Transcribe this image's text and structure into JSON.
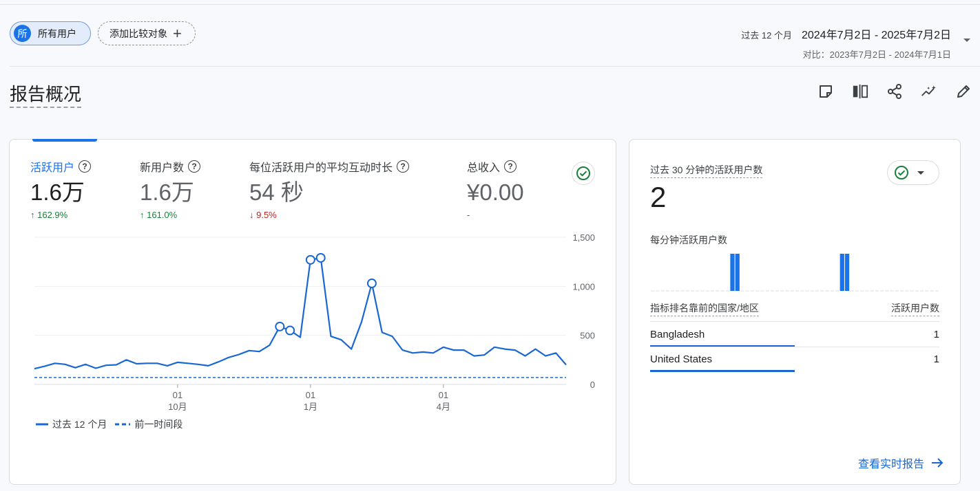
{
  "filters": {
    "all_users_avatar": "所",
    "all_users_label": "所有用户",
    "add_comparison_label": "添加比较对象",
    "add_icon": "plus-icon"
  },
  "date_range": {
    "preset": "过去 12 个月",
    "range": "2024年7月2日 - 2025年7月2日",
    "compare": "对比：2023年7月2日 - 2024年7月1日"
  },
  "page_title": "报告概况",
  "toolbar": {
    "icons": [
      "note-icon",
      "compare-columns-icon",
      "share-icon",
      "insights-icon",
      "edit-icon"
    ]
  },
  "metrics": [
    {
      "label": "活跃用户",
      "value": "1.6万",
      "change": "↑ 162.9%",
      "direction": "up"
    },
    {
      "label": "新用户数",
      "value": "1.6万",
      "change": "↑ 161.0%",
      "direction": "up"
    },
    {
      "label": "每位活跃用户的平均互动时长",
      "value": "54 秒",
      "change": "↓ 9.5%",
      "direction": "down"
    },
    {
      "label": "总收入",
      "value": "¥0.00",
      "change": "-",
      "direction": "none"
    }
  ],
  "chart_data": {
    "type": "line",
    "y_ticks": [
      "1,500",
      "1,000",
      "500",
      "0"
    ],
    "ylim": [
      0,
      1500
    ],
    "x_ticks": [
      {
        "day": "01",
        "month": "10月",
        "index": 14
      },
      {
        "day": "01",
        "month": "1月",
        "index": 27
      },
      {
        "day": "01",
        "month": "4月",
        "index": 40
      }
    ],
    "series": [
      {
        "name": "过去 12 个月",
        "style": "solid",
        "color": "#1967d2",
        "values": [
          160,
          185,
          215,
          205,
          170,
          205,
          165,
          195,
          200,
          250,
          210,
          215,
          215,
          190,
          225,
          215,
          205,
          190,
          230,
          275,
          305,
          345,
          335,
          400,
          590,
          550,
          480,
          1270,
          1290,
          490,
          455,
          360,
          640,
          1030,
          530,
          490,
          350,
          320,
          330,
          320,
          380,
          350,
          350,
          290,
          300,
          380,
          360,
          350,
          290,
          360,
          290,
          320,
          200
        ],
        "markers": [
          24,
          25,
          27,
          28,
          33
        ]
      },
      {
        "name": "前一时间段",
        "style": "dashed",
        "color": "#1967d2",
        "values": [
          70,
          70,
          70,
          70,
          70,
          70,
          70,
          70,
          70,
          70,
          70,
          70,
          70,
          70,
          70,
          70,
          70,
          70,
          70,
          70,
          70,
          70,
          70,
          70,
          70,
          70,
          70,
          70,
          70,
          70,
          70,
          70,
          70,
          70,
          70,
          70,
          70,
          70,
          70,
          70,
          70,
          70,
          70,
          70,
          70,
          70,
          70,
          70,
          70,
          70,
          70,
          70,
          70
        ]
      }
    ]
  },
  "legend": {
    "current": "过去 12 个月",
    "previous": "前一时间段"
  },
  "realtime": {
    "title": "过去 30 分钟的活跃用户数",
    "value": "2",
    "per_minute_label": "每分钟活跃用户数",
    "per_minute": [
      0,
      0,
      0,
      0,
      0,
      0,
      0,
      0,
      0,
      0,
      0,
      0,
      0,
      0,
      0,
      0,
      1,
      1,
      0,
      0,
      0,
      0,
      0,
      0,
      0,
      0,
      0,
      0,
      0,
      0,
      0,
      0,
      0,
      0,
      0,
      0,
      0,
      0,
      1,
      1,
      0,
      0,
      0,
      0,
      0,
      0,
      0,
      0,
      0,
      0,
      0,
      0,
      0,
      0,
      0,
      0,
      0,
      0
    ],
    "table": {
      "col1": "指标排名靠前的国家/地区",
      "col2": "活跃用户数",
      "rows": [
        {
          "country": "Bangladesh",
          "value": "1",
          "share": 0.5
        },
        {
          "country": "United States",
          "value": "1",
          "share": 0.5
        }
      ]
    },
    "view_link": "查看实时报告"
  }
}
